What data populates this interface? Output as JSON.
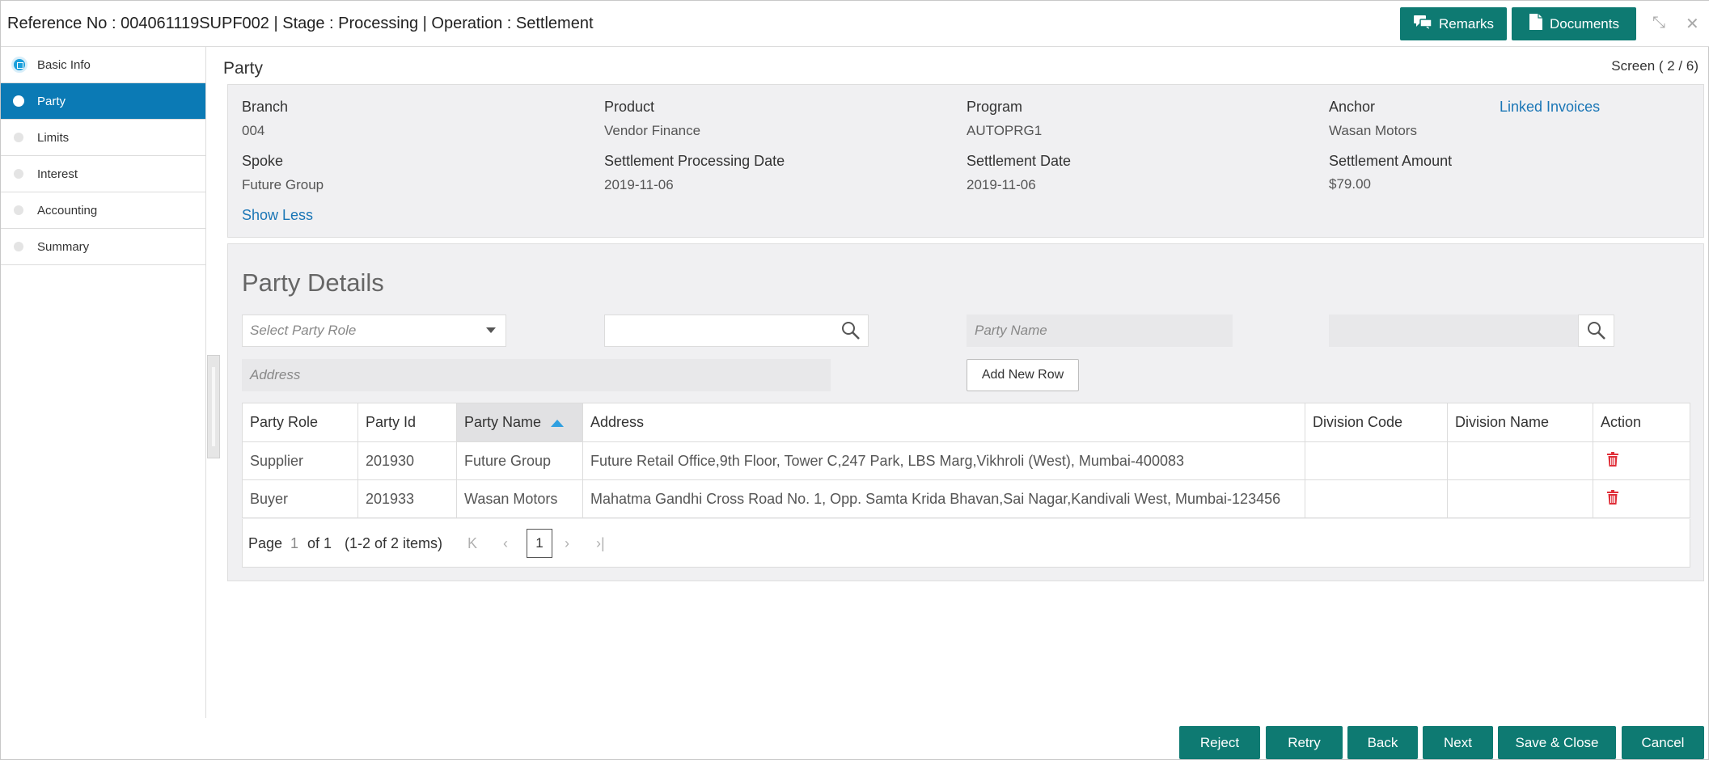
{
  "header": {
    "title": "Reference No : 004061119SUPF002 | Stage : Processing | Operation : Settlement",
    "remarks_label": "Remarks",
    "documents_label": "Documents",
    "minimize_glyph": "⤡",
    "close_glyph": "✕"
  },
  "sidebar": {
    "items": [
      {
        "label": "Basic Info"
      },
      {
        "label": "Party"
      },
      {
        "label": "Limits"
      },
      {
        "label": "Interest"
      },
      {
        "label": "Accounting"
      },
      {
        "label": "Summary"
      }
    ]
  },
  "main": {
    "section_title": "Party",
    "screen_count": "Screen ( 2 / 6)"
  },
  "info": {
    "branch": {
      "label": "Branch",
      "value": "004"
    },
    "product": {
      "label": "Product",
      "value": "Vendor Finance"
    },
    "program": {
      "label": "Program",
      "value": "AUTOPRG1"
    },
    "anchor": {
      "label": "Anchor",
      "value": "Wasan Motors"
    },
    "linked_invoices": "Linked Invoices",
    "spoke": {
      "label": "Spoke",
      "value": "Future Group"
    },
    "settlement_processing_date": {
      "label": "Settlement Processing Date",
      "value": "2019-11-06"
    },
    "settlement_date": {
      "label": "Settlement Date",
      "value": "2019-11-06"
    },
    "settlement_amount": {
      "label": "Settlement Amount",
      "value": "$79.00"
    },
    "show_less": "Show Less"
  },
  "party_details": {
    "title": "Party Details",
    "party_role_placeholder": "Select Party Role",
    "party_id_value": "",
    "party_name_placeholder": "Party Name",
    "party_name_value": "",
    "address_placeholder": "Address",
    "add_row_label": "Add New Row"
  },
  "table": {
    "columns": [
      "Party Role",
      "Party Id",
      "Party Name",
      "Address",
      "Division Code",
      "Division Name",
      "Action"
    ],
    "rows": [
      {
        "role": "Supplier",
        "id": "201930",
        "name": "Future Group",
        "address": "Future Retail Office,9th Floor, Tower C,247 Park, LBS Marg,Vikhroli (West), Mumbai-400083",
        "division_code": "",
        "division_name": ""
      },
      {
        "role": "Buyer",
        "id": "201933",
        "name": "Wasan Motors",
        "address": "Mahatma Gandhi Cross Road No. 1, Opp. Samta Krida Bhavan,Sai Nagar,Kandivali West, Mumbai-123456",
        "division_code": "",
        "division_name": ""
      }
    ]
  },
  "pager": {
    "page_label": "Page",
    "current_page": "1",
    "of_label": "of 1",
    "items_summary": "(1-2 of 2 items)",
    "page_box": "1",
    "first_glyph": "K",
    "prev_glyph": "‹",
    "next_glyph": "›",
    "last_glyph": "›|"
  },
  "footer": {
    "reject": "Reject",
    "retry": "Retry",
    "back": "Back",
    "next": "Next",
    "save_close": "Save & Close",
    "cancel": "Cancel"
  },
  "colors": {
    "accent": "#0e7a72",
    "active_nav": "#0b7ab5",
    "link": "#1a76b6",
    "delete_icon": "#e0303a"
  }
}
